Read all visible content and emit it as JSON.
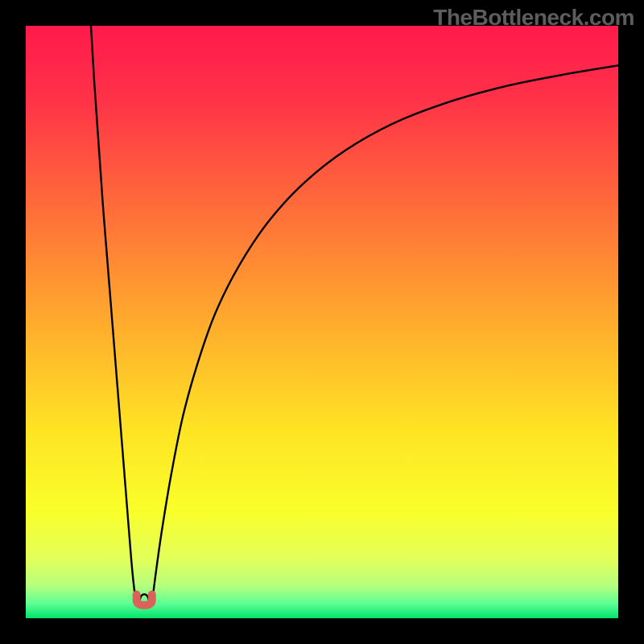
{
  "watermark": "TheBottleneck.com",
  "chart_data": {
    "type": "line",
    "title": "",
    "xlabel": "",
    "ylabel": "",
    "xlim": [
      0,
      100
    ],
    "ylim": [
      0,
      100
    ],
    "grid": false,
    "legend": false,
    "background": {
      "type": "vertical-gradient",
      "description": "red at top through orange/yellow to green at bottom",
      "stops": [
        {
          "pos": 0.0,
          "color": "#ff1a4c"
        },
        {
          "pos": 0.12,
          "color": "#ff3148"
        },
        {
          "pos": 0.3,
          "color": "#ff6a3a"
        },
        {
          "pos": 0.5,
          "color": "#ffab2d"
        },
        {
          "pos": 0.68,
          "color": "#ffe324"
        },
        {
          "pos": 0.82,
          "color": "#f9ff2a"
        },
        {
          "pos": 0.9,
          "color": "#e2ff5a"
        },
        {
          "pos": 0.945,
          "color": "#b6ff7d"
        },
        {
          "pos": 0.975,
          "color": "#5eff94"
        },
        {
          "pos": 1.0,
          "color": "#00e36b"
        }
      ]
    },
    "series": [
      {
        "name": "left-branch",
        "x": [
          11.0,
          11.6,
          12.3,
          13.0,
          13.8,
          14.6,
          15.4,
          16.2,
          17.0,
          17.8,
          18.3,
          18.7
        ],
        "y": [
          100.0,
          90.0,
          80.0,
          70.0,
          60.0,
          50.0,
          40.0,
          30.0,
          20.0,
          10.0,
          5.0,
          2.5
        ]
      },
      {
        "name": "notch-base",
        "x": [
          18.7,
          19.0,
          19.4,
          19.8,
          20.2,
          20.6,
          21.0,
          21.3
        ],
        "y": [
          2.5,
          2.2,
          3.6,
          4.0,
          4.0,
          3.6,
          2.2,
          2.5
        ]
      },
      {
        "name": "right-branch",
        "x": [
          21.3,
          22.0,
          23.0,
          24.5,
          26.5,
          29.0,
          32.0,
          36.0,
          41.0,
          47.0,
          54.0,
          62.0,
          71.0,
          81.0,
          91.0,
          100.0
        ],
        "y": [
          2.5,
          8.0,
          15.0,
          24.0,
          34.0,
          43.0,
          51.5,
          59.5,
          67.0,
          73.5,
          79.0,
          83.5,
          87.0,
          89.8,
          91.8,
          93.3
        ]
      }
    ],
    "notch_marker": {
      "description": "small salmon U-shape at curve minimum",
      "center_x": 20.0,
      "top_y": 4.0,
      "bottom_y": 2.2,
      "half_width": 1.3,
      "color": "#d9635a"
    }
  }
}
